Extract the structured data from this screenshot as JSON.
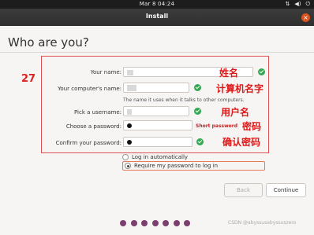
{
  "topbar": {
    "clock": "Mar 8  04:24",
    "network_icon": "network-icon",
    "volume_icon": "volume-icon",
    "power_icon": "power-icon"
  },
  "window": {
    "title": "Install"
  },
  "page": {
    "heading": "Who are you?"
  },
  "annotation": {
    "number": "27"
  },
  "form": {
    "name_label": "Your name:",
    "computer_label": "Your computer's name:",
    "computer_hint": "The name it uses when it talks to other computers.",
    "username_label": "Pick a username:",
    "password_label": "Choose a password:",
    "password_strength": "Short password",
    "confirm_label": "Confirm your password:",
    "login_auto": "Log in automatically",
    "login_require": "Require my password to log in"
  },
  "callouts": {
    "name": "姓名",
    "computer": "计算机名字",
    "username": "用户名",
    "password": "密码",
    "confirm": "确认密码"
  },
  "buttons": {
    "back": "Back",
    "continue": "Continue"
  },
  "progress": {
    "total_steps": 7
  },
  "watermark": "CSDN @abyssusabyssuszero",
  "colors": {
    "accent": "#7b3f6e",
    "annotation": "#e02020",
    "check": "#34a853",
    "close": "#d9531e"
  }
}
